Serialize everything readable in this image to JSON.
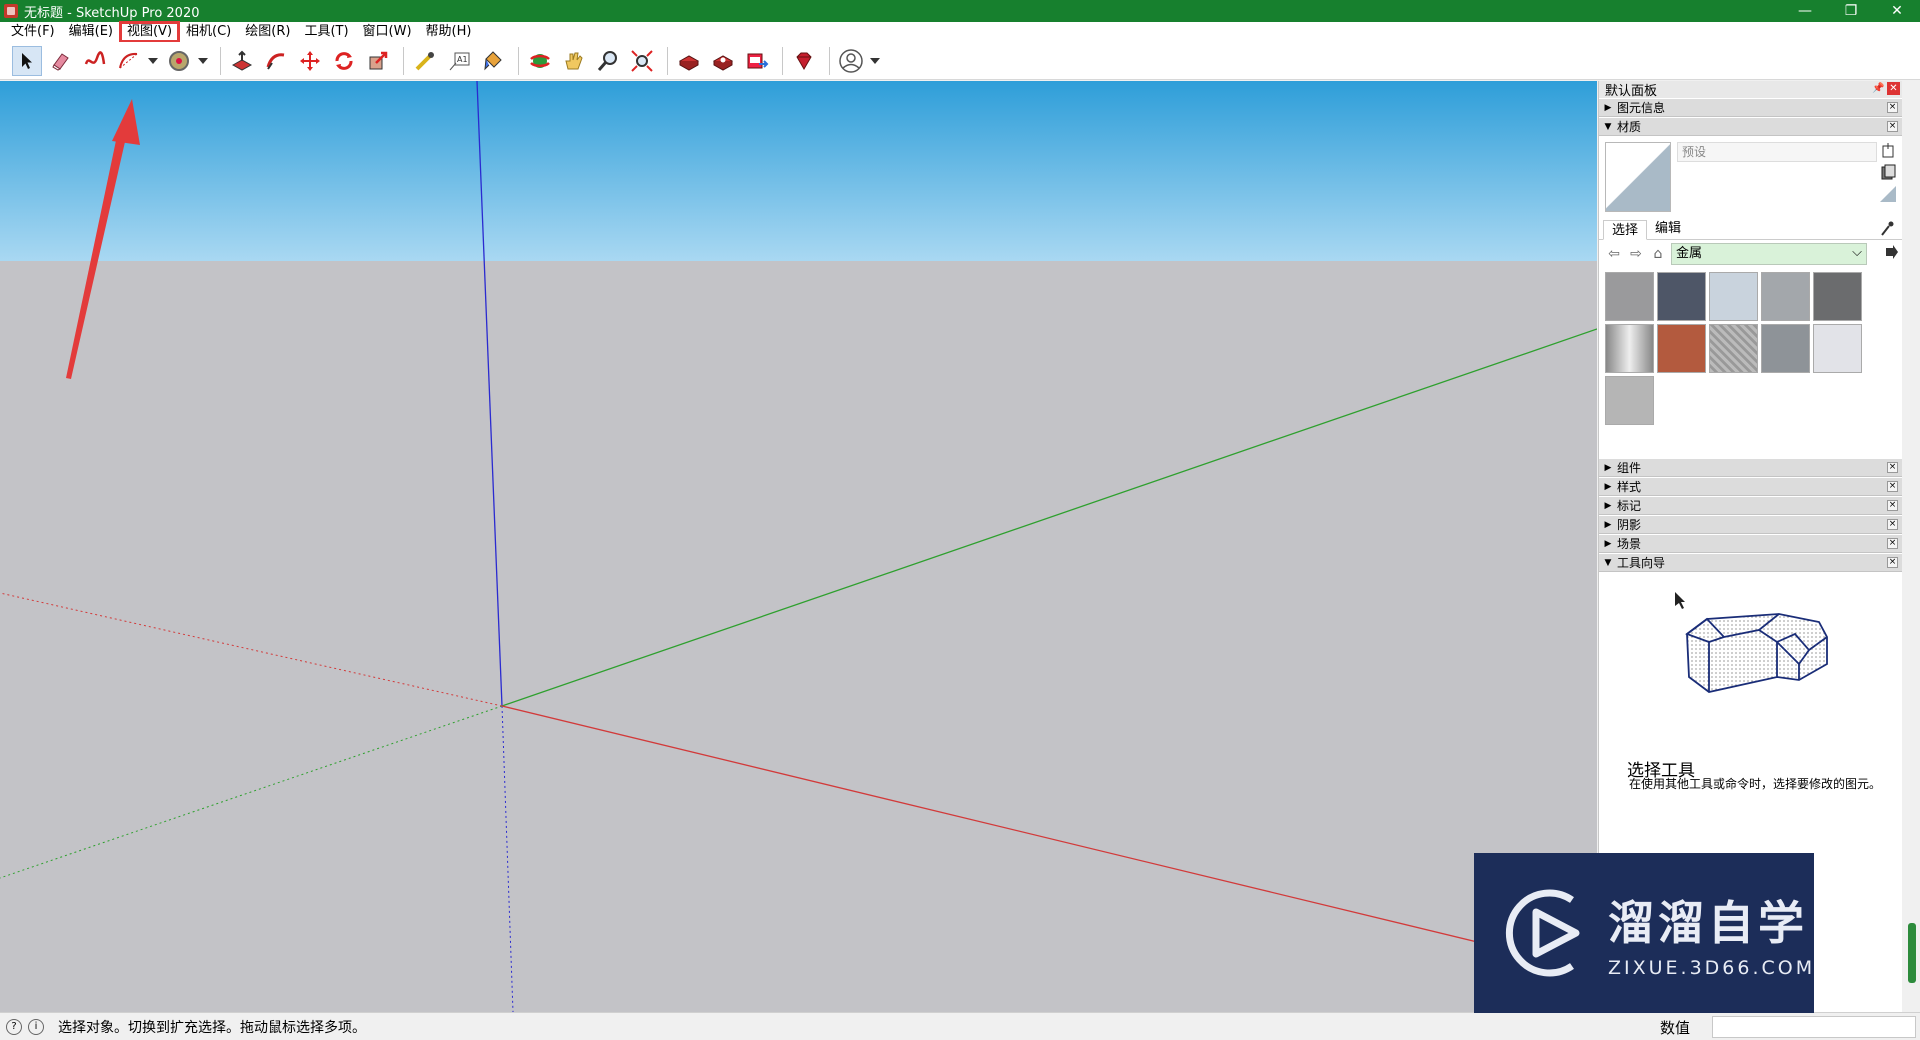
{
  "window": {
    "title": "无标题 - SketchUp Pro 2020",
    "controls": [
      "—",
      "❐",
      "✕"
    ]
  },
  "menubar": {
    "items": [
      "文件(F)",
      "编辑(E)",
      "视图(V)",
      "相机(C)",
      "绘图(R)",
      "工具(T)",
      "窗口(W)",
      "帮助(H)"
    ],
    "highlighted": "视图(V)"
  },
  "toolbar": {
    "icons": [
      "select-icon",
      "eraser-icon",
      "freehand-icon",
      "arc-icon",
      "circle-icon",
      "paint-bucket-icon",
      "push-pull-icon",
      "follow-me-icon",
      "move-icon",
      "rotate-icon",
      "scale-icon",
      "tape-measure-icon",
      "text-icon",
      "paint-icon",
      "orbit-icon",
      "pan-icon",
      "zoom-icon",
      "zoom-extents-icon",
      "warehouse-icon",
      "extension-warehouse-icon",
      "send-to-layout-icon",
      "ruby-icon",
      "account-icon"
    ]
  },
  "colors": {
    "titlebar": "#17802e",
    "sky_top": "#2e9ed9",
    "sky_bottom": "#a9d8f2",
    "ground": "#c3c3c7",
    "axis_red": "#d23a3a",
    "axis_green": "#2ea02e",
    "axis_blue": "#2a2ad0",
    "annotation_red": "#e33b3b",
    "material_select_bg": "#d9f2d9",
    "watermark_bg": "#1c2d59"
  },
  "panel": {
    "title": "默认面板",
    "entity_info": "图元信息",
    "materials": {
      "label": "材质",
      "name_placeholder": "预设",
      "tabs": [
        "选择",
        "编辑"
      ],
      "active_tab": "选择",
      "library": "金属",
      "swatch_colors": [
        "#9a9a9c",
        "#4e5667",
        "#c9d3dd",
        "#a3a7ab",
        "#6b6c6e",
        "#b0b0b0",
        "#b35a3e",
        "#a7a7a7",
        "#8e9398",
        "#e2e3e8",
        "#b5b5b5"
      ]
    },
    "trays": [
      "组件",
      "样式",
      "标记",
      "阴影",
      "场景"
    ],
    "tool_guide": {
      "label": "工具向导",
      "title": "选择工具",
      "description": "在使用其他工具或命令时，选择要修改的图元。"
    }
  },
  "status": {
    "hint": "选择对象。切换到扩充选择。拖动鼠标选择多项。",
    "measure_label": "数值",
    "measure_value": ""
  },
  "watermark": {
    "brand": "溜溜自学",
    "url": "ZIXUE.3D66.COM"
  }
}
